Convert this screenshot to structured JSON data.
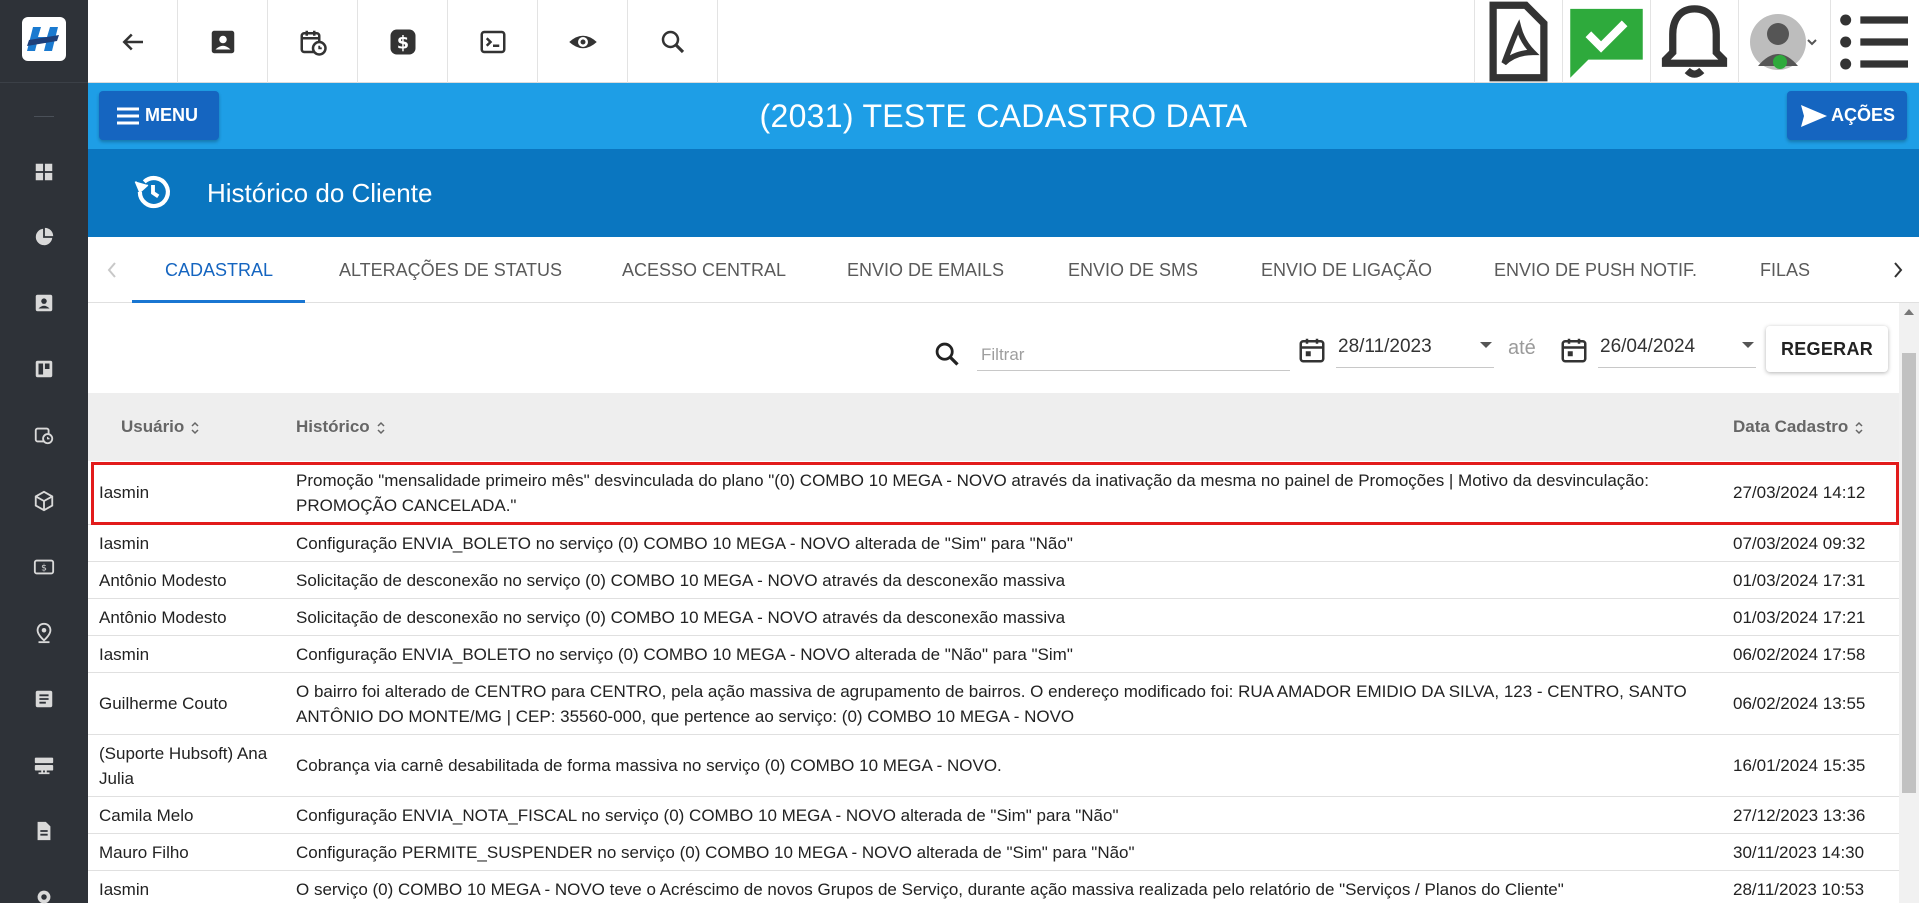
{
  "header": {
    "title": "(2031) TESTE CADASTRO DATA",
    "menu_label": "MENU",
    "actions_label": "AÇÕES"
  },
  "section": {
    "title": "Histórico do Cliente"
  },
  "tabs": [
    {
      "label": "CADASTRAL",
      "active": true
    },
    {
      "label": "ALTERAÇÕES DE STATUS"
    },
    {
      "label": "ACESSO CENTRAL"
    },
    {
      "label": "ENVIO DE EMAILS"
    },
    {
      "label": "ENVIO DE SMS"
    },
    {
      "label": "ENVIO DE LIGAÇÃO"
    },
    {
      "label": "ENVIO DE PUSH NOTIF."
    },
    {
      "label": "FILAS"
    }
  ],
  "filter": {
    "placeholder": "Filtrar",
    "date_from": "28/11/2023",
    "date_to": "26/04/2024",
    "between_label": "até",
    "regenerate_label": "REGERAR"
  },
  "table": {
    "columns": [
      "Usuário",
      "Histórico",
      "Data Cadastro"
    ],
    "rows": [
      {
        "user": "Iasmin",
        "history": "Promoção \"mensalidade primeiro mês\" desvinculada do plano \"(0) COMBO 10 MEGA - NOVO através da inativação da mesma no painel de Promoções | Motivo da desvinculação: PROMOÇÃO CANCELADA.\"",
        "date": "27/03/2024 14:12"
      },
      {
        "user": "Iasmin",
        "history": "Configuração ENVIA_BOLETO no serviço (0) COMBO 10 MEGA - NOVO alterada de \"Sim\" para \"Não\"",
        "date": "07/03/2024 09:32"
      },
      {
        "user": "Antônio Modesto",
        "history": "Solicitação de desconexão no serviço (0) COMBO 10 MEGA - NOVO através da desconexão massiva",
        "date": "01/03/2024 17:31"
      },
      {
        "user": "Antônio Modesto",
        "history": "Solicitação de desconexão no serviço (0) COMBO 10 MEGA - NOVO através da desconexão massiva",
        "date": "01/03/2024 17:21"
      },
      {
        "user": "Iasmin",
        "history": "Configuração ENVIA_BOLETO no serviço (0) COMBO 10 MEGA - NOVO alterada de \"Não\" para \"Sim\"",
        "date": "06/02/2024 17:58"
      },
      {
        "user": "Guilherme Couto",
        "history": "O bairro foi alterado de CENTRO para CENTRO, pela ação massiva de agrupamento de bairros. O endereço modificado foi: RUA AMADOR EMIDIO DA SILVA, 123 - CENTRO, SANTO ANTÔNIO DO MONTE/MG | CEP: 35560-000, que pertence ao serviço: (0) COMBO 10 MEGA - NOVO",
        "date": "06/02/2024 13:55"
      },
      {
        "user": "(Suporte Hubsoft) Ana Julia",
        "history": "Cobrança via carnê desabilitada de forma massiva no serviço (0) COMBO 10 MEGA - NOVO.",
        "date": "16/01/2024 15:35"
      },
      {
        "user": "Camila Melo",
        "history": "Configuração ENVIA_NOTA_FISCAL no serviço (0) COMBO 10 MEGA - NOVO alterada de \"Sim\" para \"Não\"",
        "date": "27/12/2023 13:36"
      },
      {
        "user": "Mauro Filho",
        "history": "Configuração PERMITE_SUSPENDER no serviço (0) COMBO 10 MEGA - NOVO alterada de \"Sim\" para \"Não\"",
        "date": "30/11/2023 14:30"
      },
      {
        "user": "Iasmin",
        "history": "O serviço (0) COMBO 10 MEGA - NOVO teve o Acréscimo de novos Grupos de Serviço, durante ação massiva realizada pelo relatório de \"Serviços / Planos do Cliente\"",
        "date": "28/11/2023 10:53"
      }
    ]
  },
  "colors": {
    "sidebar": "#2e3238",
    "title_bar": "#1e9ee6",
    "section_bar": "#0a76c0",
    "button_blue": "#1565c0",
    "highlight": "#e21b1b",
    "online_badge": "#2eaa3c"
  },
  "icons": {
    "toolbar_left": [
      "back-arrow-icon",
      "contact-card-icon",
      "schedule-icon",
      "dollar-icon",
      "terminal-icon",
      "eye-icon",
      "search-icon"
    ],
    "toolbar_right": [
      "pdf-icon",
      "chat-check-icon",
      "bell-icon",
      "user-avatar",
      "list-icon"
    ],
    "sidebar": [
      "dashboard-icon",
      "pie-chart-icon",
      "contact-card-icon",
      "kanban-icon",
      "schedule-icon",
      "box-icon",
      "money-icon",
      "location-icon",
      "list-icon",
      "server-icon",
      "document-icon",
      "gear-icon"
    ]
  }
}
